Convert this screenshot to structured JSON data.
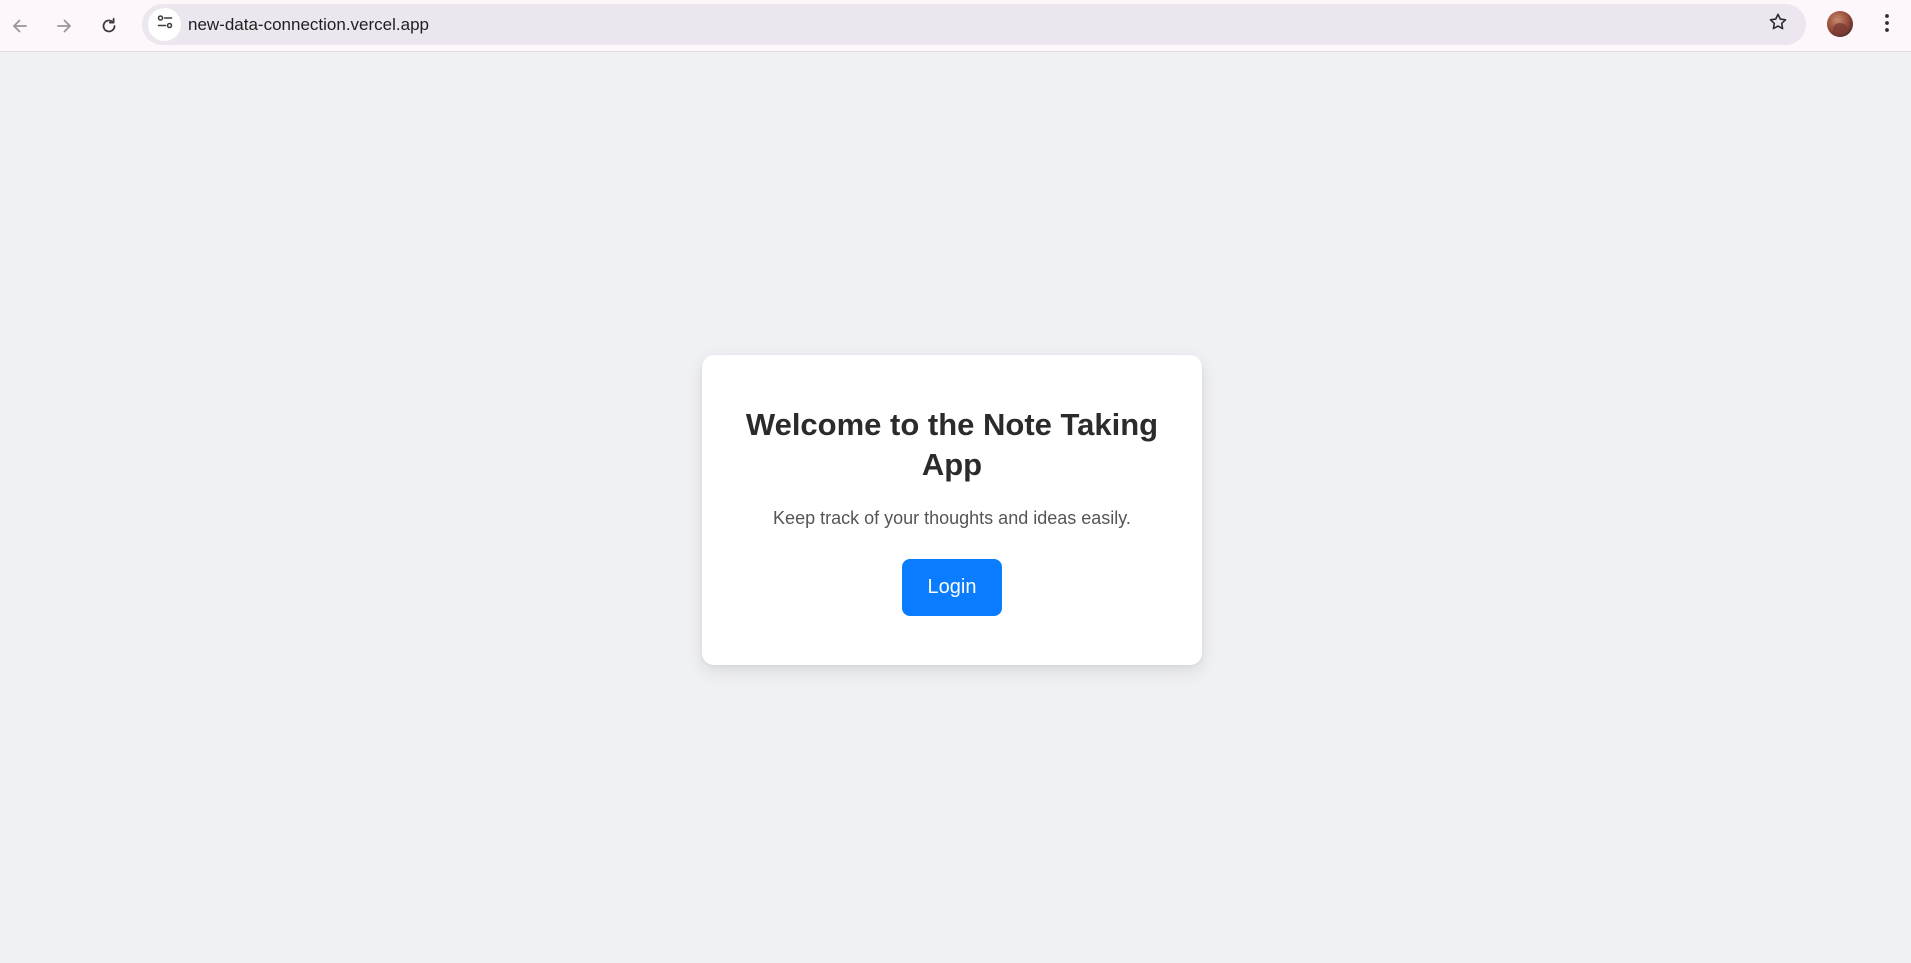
{
  "browser": {
    "url": "new-data-connection.vercel.app",
    "icons": {
      "back": "back-arrow-icon",
      "forward": "forward-arrow-icon",
      "reload": "reload-icon",
      "site_info": "site-settings-icon",
      "bookmark": "star-icon",
      "menu": "vertical-dots-icon"
    }
  },
  "card": {
    "title": "Welcome to the Note Taking App",
    "subtitle": "Keep track of your thoughts and ideas easily.",
    "login_label": "Login"
  },
  "colors": {
    "page_background": "#f0f1f5",
    "card_background": "#ffffff",
    "accent": "#0a7cff",
    "title_text": "#2b2b2b",
    "subtitle_text": "#555555",
    "toolbar_background": "#fdf6fb",
    "omnibox_background": "#ece6ef"
  }
}
